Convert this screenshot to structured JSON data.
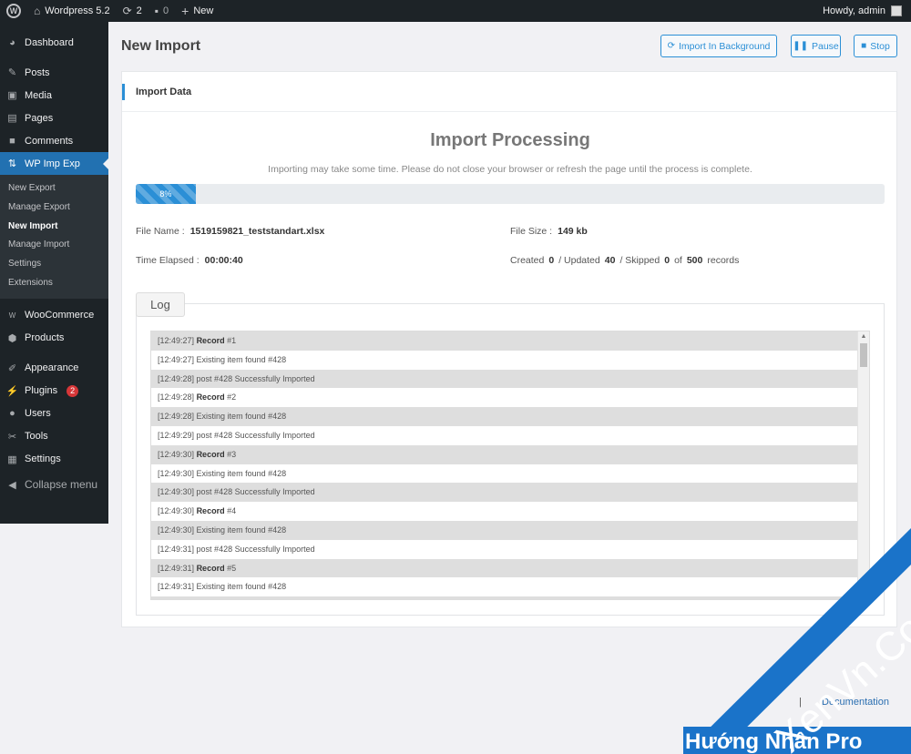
{
  "adminbar": {
    "site_name": "Wordpress 5.2",
    "updates_count": "2",
    "comments_count": "0",
    "new_label": "New",
    "howdy": "Howdy, admin"
  },
  "sidebar": {
    "items": [
      {
        "label": "Dashboard",
        "icon": "dashboard-icon"
      },
      {
        "label": "Posts",
        "icon": "pin-icon"
      },
      {
        "label": "Media",
        "icon": "media-icon"
      },
      {
        "label": "Pages",
        "icon": "pages-icon"
      },
      {
        "label": "Comments",
        "icon": "comment-icon"
      },
      {
        "label": "WP Imp Exp",
        "icon": "import-export-icon"
      }
    ],
    "submenu": [
      "New Export",
      "Manage Export",
      "New Import",
      "Manage Import",
      "Settings",
      "Extensions"
    ],
    "items2": [
      {
        "label": "WooCommerce",
        "icon": "woocommerce-icon"
      },
      {
        "label": "Products",
        "icon": "products-icon"
      },
      {
        "label": "Appearance",
        "icon": "brush-icon"
      },
      {
        "label": "Plugins",
        "icon": "plugin-icon",
        "badge": "2"
      },
      {
        "label": "Users",
        "icon": "user-icon"
      },
      {
        "label": "Tools",
        "icon": "wrench-icon"
      },
      {
        "label": "Settings",
        "icon": "settings-icon"
      }
    ],
    "collapse": "Collapse menu"
  },
  "page": {
    "title": "New Import",
    "buttons": {
      "background": "Import In Background",
      "pause": "Pause",
      "stop": "Stop"
    }
  },
  "card": {
    "header": "Import Data",
    "processing_title": "Import Processing",
    "note": "Importing may take some time. Please do not close your browser or refresh the page until the process is complete.",
    "progress_label": "8%",
    "progress_value": 0.08,
    "file_name_label": "File Name :",
    "file_name": "1519159821_teststandart.xlsx",
    "file_size_label": "File Size :",
    "file_size": "149 kb",
    "time_elapsed_label": "Time Elapsed :",
    "time_elapsed": "00:00:40",
    "stats": {
      "created_label": "Created",
      "created": "0",
      "updated_label": "/ Updated",
      "updated": "40",
      "skipped_label": "/ Skipped",
      "skipped": "0",
      "of_label": "of",
      "total": "500",
      "records_label": "records"
    }
  },
  "log": {
    "legend": "Log",
    "rows": [
      {
        "time": "[12:49:27]",
        "strong": "Record",
        "rest": " #1"
      },
      {
        "time": "[12:49:27]",
        "strong": "",
        "rest": " Existing item found #428"
      },
      {
        "time": "[12:49:28]",
        "strong": "",
        "rest": " post #428 Successfully Imported"
      },
      {
        "time": "[12:49:28]",
        "strong": "Record",
        "rest": " #2"
      },
      {
        "time": "[12:49:28]",
        "strong": "",
        "rest": " Existing item found #428"
      },
      {
        "time": "[12:49:29]",
        "strong": "",
        "rest": " post #428 Successfully Imported"
      },
      {
        "time": "[12:49:30]",
        "strong": "Record",
        "rest": " #3"
      },
      {
        "time": "[12:49:30]",
        "strong": "",
        "rest": " Existing item found #428"
      },
      {
        "time": "[12:49:30]",
        "strong": "",
        "rest": " post #428 Successfully Imported"
      },
      {
        "time": "[12:49:30]",
        "strong": "Record",
        "rest": " #4"
      },
      {
        "time": "[12:49:30]",
        "strong": "",
        "rest": " Existing item found #428"
      },
      {
        "time": "[12:49:31]",
        "strong": "",
        "rest": " post #428 Successfully Imported"
      },
      {
        "time": "[12:49:31]",
        "strong": "Record",
        "rest": " #5"
      },
      {
        "time": "[12:49:31]",
        "strong": "",
        "rest": " Existing item found #428"
      },
      {
        "time": "",
        "strong": "",
        "rest": ""
      }
    ]
  },
  "footer": {
    "separator": "|",
    "documentation": "Documentation"
  },
  "watermark": {
    "line1": "XenVn.Com",
    "line2": "Hướng Nhân Pro"
  }
}
